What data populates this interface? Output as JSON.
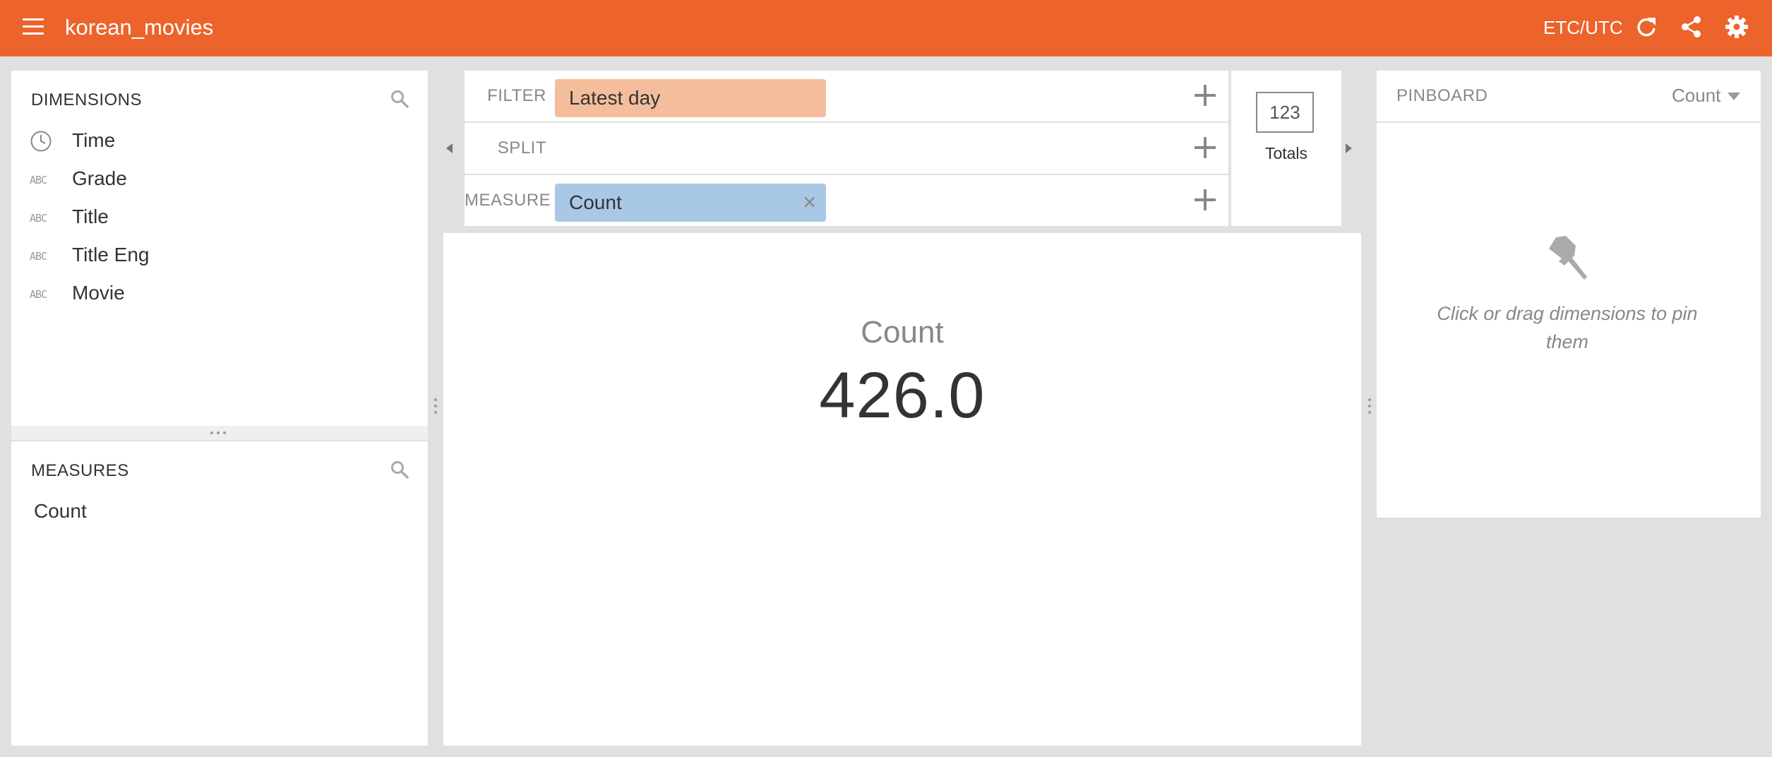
{
  "header": {
    "title": "korean_movies",
    "timezone": "ETC/UTC",
    "icons": [
      "menu-icon",
      "refresh-icon",
      "share-icon",
      "settings-icon"
    ],
    "accent_color": "#ec642b"
  },
  "dimensions": {
    "title": "DIMENSIONS",
    "items": [
      {
        "label": "Time",
        "icon": "clock-icon"
      },
      {
        "label": "Grade",
        "icon": "string-icon"
      },
      {
        "label": "Title",
        "icon": "string-icon"
      },
      {
        "label": "Title Eng",
        "icon": "string-icon"
      },
      {
        "label": "Movie",
        "icon": "string-icon"
      }
    ]
  },
  "measures": {
    "title": "MEASURES",
    "items": [
      {
        "label": "Count"
      }
    ]
  },
  "controls": {
    "filter": {
      "label": "FILTER",
      "pill": "Latest day",
      "color": "#f4be9c"
    },
    "split": {
      "label": "SPLIT"
    },
    "measure": {
      "label": "MEASURE",
      "pill": "Count",
      "color": "#a8c8e6",
      "remove_glyph": "×"
    }
  },
  "visualization": {
    "icon_text": "123",
    "label": "Totals"
  },
  "main": {
    "measure_title": "Count",
    "measure_value": "426.0"
  },
  "pinboard": {
    "title": "PINBOARD",
    "sort_by": "Count",
    "empty_message": "Click or drag dimensions to pin them"
  }
}
